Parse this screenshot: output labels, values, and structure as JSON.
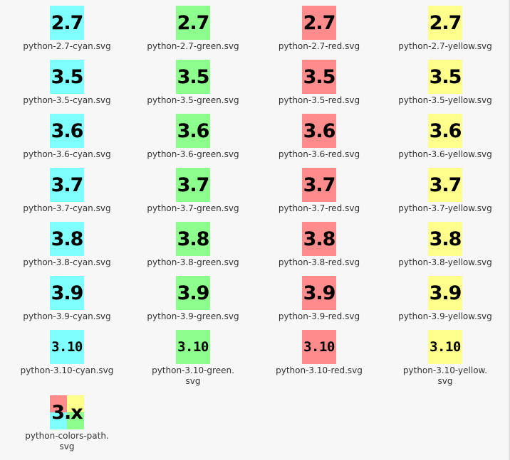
{
  "colors": {
    "cyan": "#80ffff",
    "green": "#8cff8c",
    "red": "#ff8c8c",
    "yellow": "#ffff8c",
    "background": "#f7f7f7"
  },
  "rows": [
    {
      "version": "2.7",
      "files": [
        {
          "color": "cyan",
          "label": "python-2.7-cyan.svg"
        },
        {
          "color": "green",
          "label": "python-2.7-green.svg"
        },
        {
          "color": "red",
          "label": "python-2.7-red.svg"
        },
        {
          "color": "yellow",
          "label": "python-2.7-yellow.svg"
        }
      ]
    },
    {
      "version": "3.5",
      "files": [
        {
          "color": "cyan",
          "label": "python-3.5-cyan.svg"
        },
        {
          "color": "green",
          "label": "python-3.5-green.svg"
        },
        {
          "color": "red",
          "label": "python-3.5-red.svg"
        },
        {
          "color": "yellow",
          "label": "python-3.5-yellow.svg"
        }
      ]
    },
    {
      "version": "3.6",
      "files": [
        {
          "color": "cyan",
          "label": "python-3.6-cyan.svg"
        },
        {
          "color": "green",
          "label": "python-3.6-green.svg"
        },
        {
          "color": "red",
          "label": "python-3.6-red.svg"
        },
        {
          "color": "yellow",
          "label": "python-3.6-yellow.svg"
        }
      ]
    },
    {
      "version": "3.7",
      "files": [
        {
          "color": "cyan",
          "label": "python-3.7-cyan.svg"
        },
        {
          "color": "green",
          "label": "python-3.7-green.svg"
        },
        {
          "color": "red",
          "label": "python-3.7-red.svg"
        },
        {
          "color": "yellow",
          "label": "python-3.7-yellow.svg"
        }
      ]
    },
    {
      "version": "3.8",
      "files": [
        {
          "color": "cyan",
          "label": "python-3.8-cyan.svg"
        },
        {
          "color": "green",
          "label": "python-3.8-green.svg"
        },
        {
          "color": "red",
          "label": "python-3.8-red.svg"
        },
        {
          "color": "yellow",
          "label": "python-3.8-yellow.svg"
        }
      ]
    },
    {
      "version": "3.9",
      "files": [
        {
          "color": "cyan",
          "label": "python-3.9-cyan.svg"
        },
        {
          "color": "green",
          "label": "python-3.9-green.svg"
        },
        {
          "color": "red",
          "label": "python-3.9-red.svg"
        },
        {
          "color": "yellow",
          "label": "python-3.9-yellow.svg"
        }
      ]
    },
    {
      "version": "3.10",
      "files": [
        {
          "color": "cyan",
          "label": "python-3.10-cyan.svg"
        },
        {
          "color": "green",
          "label": "python-3.10-green.\nsvg"
        },
        {
          "color": "red",
          "label": "python-3.10-red.svg"
        },
        {
          "color": "yellow",
          "label": "python-3.10-yellow.\nsvg"
        }
      ]
    }
  ],
  "special": {
    "version": "3.x",
    "label": "python-colors-path.\nsvg",
    "quadrants": [
      "red",
      "yellow",
      "cyan",
      "green"
    ]
  }
}
